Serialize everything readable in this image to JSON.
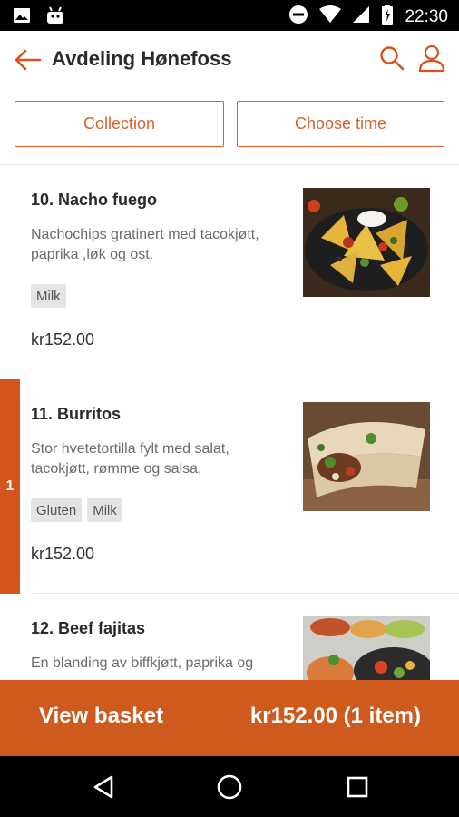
{
  "status_bar": {
    "time": "22:30",
    "icons": [
      "image-icon",
      "android-icon",
      "do-not-disturb-icon",
      "wifi-icon",
      "signal-icon",
      "battery-charging-icon"
    ]
  },
  "app_bar": {
    "title": "Avdeling Hønefoss",
    "icons": [
      "back-arrow-icon",
      "search-icon",
      "user-icon"
    ]
  },
  "filters": {
    "collection_label": "Collection",
    "time_label": "Choose time"
  },
  "menu": {
    "items": [
      {
        "name": "10. Nacho fuego",
        "description": "Nachochips gratinert med tacokjøtt, paprika ,løk og ost.",
        "tags": [
          "Milk"
        ],
        "price": "kr152.00",
        "quantity": null
      },
      {
        "name": "11. Burritos",
        "description": "Stor hvetetortilla fylt med salat, tacokjøtt, rømme og salsa.",
        "tags": [
          "Gluten",
          "Milk"
        ],
        "price": "kr152.00",
        "quantity": "1"
      },
      {
        "name": "12. Beef fajitas",
        "description": "En blanding av biffkjøtt, paprika og",
        "tags": [],
        "price": "",
        "quantity": null
      }
    ]
  },
  "basket": {
    "label": "View basket",
    "total": "kr152.00 (1 item)"
  },
  "nav": {
    "icons": [
      "back-triangle-icon",
      "home-circle-icon",
      "recents-square-icon"
    ]
  },
  "colors": {
    "accent": "#d2541e",
    "basket_bg": "#cf5a1e",
    "tag_bg": "#e4e4e4"
  }
}
